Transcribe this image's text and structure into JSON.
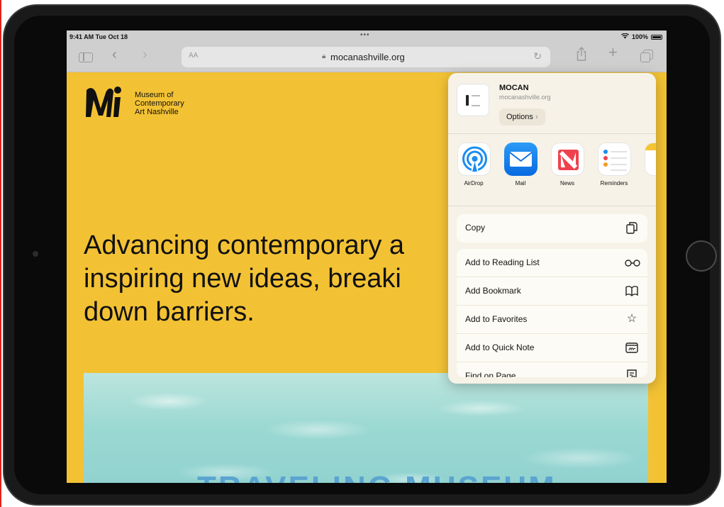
{
  "status_bar": {
    "time": "9:41 AM  Tue Oct 18",
    "dots": "•••",
    "battery": "100%"
  },
  "toolbar": {
    "text_size": "AA",
    "url": "mocanashville.org"
  },
  "page": {
    "logo_lines": [
      "Museum of",
      "Contemporary",
      "Art Nashville"
    ],
    "hero_lines": [
      "Advancing contemporary a",
      "inspiring new ideas, breaki",
      "down barriers."
    ],
    "pool_title": "TRAVELING MUSEUM"
  },
  "share_sheet": {
    "site_name": "MOCAN",
    "site_url": "mocanashville.org",
    "options_label": "Options",
    "apps": [
      {
        "label": "AirDrop",
        "icon": "airdrop-icon"
      },
      {
        "label": "Mail",
        "icon": "mail-icon"
      },
      {
        "label": "News",
        "icon": "news-icon"
      },
      {
        "label": "Reminders",
        "icon": "reminders-icon"
      },
      {
        "label": "",
        "icon": "notes-icon"
      }
    ],
    "copy": {
      "label": "Copy",
      "icon": "copy-icon"
    },
    "actions": [
      {
        "label": "Add to Reading List",
        "icon": "glasses-icon"
      },
      {
        "label": "Add Bookmark",
        "icon": "book-icon"
      },
      {
        "label": "Add to Favorites",
        "icon": "star-icon"
      },
      {
        "label": "Add to Quick Note",
        "icon": "quick-note-icon"
      },
      {
        "label": "Find on Page",
        "icon": "find-on-page-icon"
      }
    ]
  },
  "colors": {
    "page_bg": "#f3c234",
    "mail_blue": "#0a6ae0",
    "news_red": "#f0424e",
    "pool": "#9ad8d2"
  }
}
